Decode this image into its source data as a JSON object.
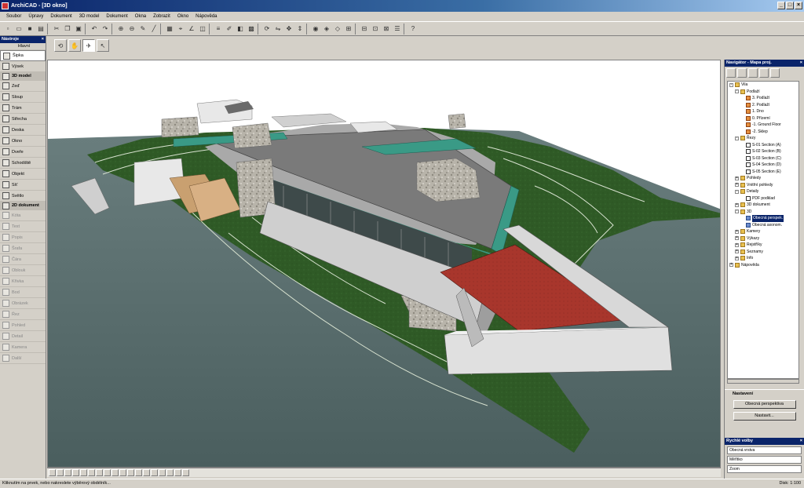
{
  "window": {
    "title": "ArchiCAD - [3D okno]",
    "buttons": [
      "_",
      "□",
      "×"
    ]
  },
  "menu": [
    "Soubor",
    "Úpravy",
    "Dokument",
    "3D model",
    "Dokument",
    "Okna",
    "Zobrazit",
    "Okno",
    "Nápověda"
  ],
  "toolbox": {
    "title": "Nástroje",
    "tab": "Hlavní",
    "items": [
      {
        "label": "Šipka",
        "icon": "arrow-icon",
        "state": "selected"
      },
      {
        "label": "Výsek",
        "icon": "marquee-icon",
        "state": "normal"
      },
      {
        "label": "3D model",
        "icon": "cube-icon",
        "state": "header"
      },
      {
        "label": "Zeď",
        "icon": "wall-icon",
        "state": "normal"
      },
      {
        "label": "Sloup",
        "icon": "column-icon",
        "state": "normal"
      },
      {
        "label": "Trám",
        "icon": "beam-icon",
        "state": "normal"
      },
      {
        "label": "Střecha",
        "icon": "roof-icon",
        "state": "normal"
      },
      {
        "label": "Deska",
        "icon": "slab-icon",
        "state": "normal"
      },
      {
        "label": "Okno",
        "icon": "window-icon",
        "state": "normal"
      },
      {
        "label": "Dveře",
        "icon": "door-icon",
        "state": "normal"
      },
      {
        "label": "Schodiště",
        "icon": "stair-icon",
        "state": "normal"
      },
      {
        "label": "Objekt",
        "icon": "object-icon",
        "state": "normal"
      },
      {
        "label": "Síť",
        "icon": "mesh-icon",
        "state": "normal"
      },
      {
        "label": "Světlo",
        "icon": "lamp-icon",
        "state": "normal"
      },
      {
        "label": "2D dokument",
        "icon": "doc-icon",
        "state": "header"
      },
      {
        "label": "Kóta",
        "icon": "dim-icon",
        "state": "dim"
      },
      {
        "label": "Text",
        "icon": "text-icon",
        "state": "dim"
      },
      {
        "label": "Popis",
        "icon": "label-icon",
        "state": "dim"
      },
      {
        "label": "Šrafa",
        "icon": "fill-icon",
        "state": "dim"
      },
      {
        "label": "Čára",
        "icon": "line-icon",
        "state": "dim"
      },
      {
        "label": "Oblouk",
        "icon": "arc-icon",
        "state": "dim"
      },
      {
        "label": "Křivka",
        "icon": "spline-icon",
        "state": "dim"
      },
      {
        "label": "Bod",
        "icon": "hotspot-icon",
        "state": "dim"
      },
      {
        "label": "Obrázek",
        "icon": "picture-icon",
        "state": "dim"
      },
      {
        "label": "Řez",
        "icon": "section-icon",
        "state": "dim"
      },
      {
        "label": "Pohled",
        "icon": "elevation-icon",
        "state": "dim"
      },
      {
        "label": "Detail",
        "icon": "detail-icon",
        "state": "dim"
      },
      {
        "label": "Kamera",
        "icon": "camera-icon",
        "state": "dim"
      },
      {
        "label": "Další",
        "icon": "more-icon",
        "state": "dim"
      }
    ]
  },
  "navigator": {
    "title": "Navigátor - Mapa proj.",
    "tree": [
      {
        "label": "Vila",
        "icon": "folder",
        "depth": 0,
        "exp": "-"
      },
      {
        "label": "Podlaží",
        "icon": "folder",
        "depth": 1,
        "exp": "-"
      },
      {
        "label": "3. Podlaží",
        "icon": "story",
        "depth": 2,
        "exp": ""
      },
      {
        "label": "2. Podlaží",
        "icon": "story",
        "depth": 2,
        "exp": ""
      },
      {
        "label": "1. Dno",
        "icon": "story",
        "depth": 2,
        "exp": ""
      },
      {
        "label": "0. Přízemí",
        "icon": "story",
        "depth": 2,
        "exp": ""
      },
      {
        "label": "-1. Ground Floor",
        "icon": "story",
        "depth": 2,
        "exp": ""
      },
      {
        "label": "-2. Sklep",
        "icon": "story",
        "depth": 2,
        "exp": ""
      },
      {
        "label": "Řezy",
        "icon": "folder",
        "depth": 1,
        "exp": "-"
      },
      {
        "label": "S-01 Section (A)",
        "icon": "section",
        "depth": 2,
        "exp": ""
      },
      {
        "label": "S-02 Section (B)",
        "icon": "section",
        "depth": 2,
        "exp": ""
      },
      {
        "label": "S-03 Section (C)",
        "icon": "section",
        "depth": 2,
        "exp": ""
      },
      {
        "label": "S-04 Section (D)",
        "icon": "section",
        "depth": 2,
        "exp": ""
      },
      {
        "label": "S-05 Section (E)",
        "icon": "section",
        "depth": 2,
        "exp": ""
      },
      {
        "label": "Pohledy",
        "icon": "folder",
        "depth": 1,
        "exp": "+"
      },
      {
        "label": "Vnitřní pohledy",
        "icon": "folder",
        "depth": 1,
        "exp": "+"
      },
      {
        "label": "Detaily",
        "icon": "folder",
        "depth": 1,
        "exp": "-"
      },
      {
        "label": "PDF podklad",
        "icon": "section",
        "depth": 2,
        "exp": ""
      },
      {
        "label": "3D dokument",
        "icon": "folder",
        "depth": 1,
        "exp": "+"
      },
      {
        "label": "3D",
        "icon": "folder",
        "depth": 1,
        "exp": "-"
      },
      {
        "label": "Obecná perspek.",
        "icon": "view",
        "depth": 2,
        "exp": "",
        "selected": true
      },
      {
        "label": "Obecná axonom.",
        "icon": "view",
        "depth": 2,
        "exp": ""
      },
      {
        "label": "Kamery",
        "icon": "folder",
        "depth": 1,
        "exp": "+"
      },
      {
        "label": "Výkazy",
        "icon": "folder",
        "depth": 1,
        "exp": "+"
      },
      {
        "label": "Rejstříky",
        "icon": "folder",
        "depth": 1,
        "exp": "+"
      },
      {
        "label": "Seznamy",
        "icon": "folder",
        "depth": 1,
        "exp": "+"
      },
      {
        "label": "Info",
        "icon": "folder",
        "depth": 1,
        "exp": "+"
      },
      {
        "label": "Nápověda",
        "icon": "folder",
        "depth": 0,
        "exp": "+"
      }
    ]
  },
  "settings": {
    "header": "Nastavení",
    "button1": "Obecná perspektiva",
    "button2": "Nastavit..."
  },
  "quick": {
    "title": "Rychlé volby",
    "row1": "Obecná vrstva",
    "row2": "Měřítko",
    "row3": "Zoom"
  },
  "status": {
    "left": "Kliknutím na prvek, nebo nakreslete výběrový obdélník...",
    "right": "Disk: 1:100"
  },
  "colors": {
    "water": "#5e7272",
    "grass": "#2f5a26",
    "roof_teal": "#3a9a86",
    "slab": "#7a7a7a",
    "terrace_red": "#a8362c"
  }
}
